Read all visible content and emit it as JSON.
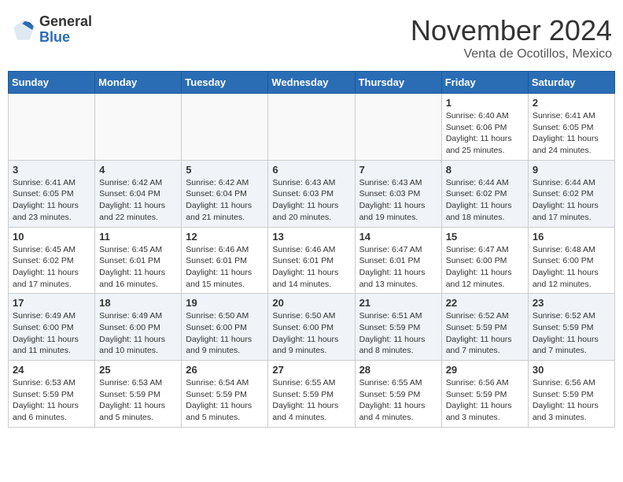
{
  "header": {
    "logo_general": "General",
    "logo_blue": "Blue",
    "month_title": "November 2024",
    "location": "Venta de Ocotillos, Mexico"
  },
  "weekdays": [
    "Sunday",
    "Monday",
    "Tuesday",
    "Wednesday",
    "Thursday",
    "Friday",
    "Saturday"
  ],
  "weeks": [
    [
      {
        "day": "",
        "info": ""
      },
      {
        "day": "",
        "info": ""
      },
      {
        "day": "",
        "info": ""
      },
      {
        "day": "",
        "info": ""
      },
      {
        "day": "",
        "info": ""
      },
      {
        "day": "1",
        "info": "Sunrise: 6:40 AM\nSunset: 6:06 PM\nDaylight: 11 hours\nand 25 minutes."
      },
      {
        "day": "2",
        "info": "Sunrise: 6:41 AM\nSunset: 6:05 PM\nDaylight: 11 hours\nand 24 minutes."
      }
    ],
    [
      {
        "day": "3",
        "info": "Sunrise: 6:41 AM\nSunset: 6:05 PM\nDaylight: 11 hours\nand 23 minutes."
      },
      {
        "day": "4",
        "info": "Sunrise: 6:42 AM\nSunset: 6:04 PM\nDaylight: 11 hours\nand 22 minutes."
      },
      {
        "day": "5",
        "info": "Sunrise: 6:42 AM\nSunset: 6:04 PM\nDaylight: 11 hours\nand 21 minutes."
      },
      {
        "day": "6",
        "info": "Sunrise: 6:43 AM\nSunset: 6:03 PM\nDaylight: 11 hours\nand 20 minutes."
      },
      {
        "day": "7",
        "info": "Sunrise: 6:43 AM\nSunset: 6:03 PM\nDaylight: 11 hours\nand 19 minutes."
      },
      {
        "day": "8",
        "info": "Sunrise: 6:44 AM\nSunset: 6:02 PM\nDaylight: 11 hours\nand 18 minutes."
      },
      {
        "day": "9",
        "info": "Sunrise: 6:44 AM\nSunset: 6:02 PM\nDaylight: 11 hours\nand 17 minutes."
      }
    ],
    [
      {
        "day": "10",
        "info": "Sunrise: 6:45 AM\nSunset: 6:02 PM\nDaylight: 11 hours\nand 17 minutes."
      },
      {
        "day": "11",
        "info": "Sunrise: 6:45 AM\nSunset: 6:01 PM\nDaylight: 11 hours\nand 16 minutes."
      },
      {
        "day": "12",
        "info": "Sunrise: 6:46 AM\nSunset: 6:01 PM\nDaylight: 11 hours\nand 15 minutes."
      },
      {
        "day": "13",
        "info": "Sunrise: 6:46 AM\nSunset: 6:01 PM\nDaylight: 11 hours\nand 14 minutes."
      },
      {
        "day": "14",
        "info": "Sunrise: 6:47 AM\nSunset: 6:01 PM\nDaylight: 11 hours\nand 13 minutes."
      },
      {
        "day": "15",
        "info": "Sunrise: 6:47 AM\nSunset: 6:00 PM\nDaylight: 11 hours\nand 12 minutes."
      },
      {
        "day": "16",
        "info": "Sunrise: 6:48 AM\nSunset: 6:00 PM\nDaylight: 11 hours\nand 12 minutes."
      }
    ],
    [
      {
        "day": "17",
        "info": "Sunrise: 6:49 AM\nSunset: 6:00 PM\nDaylight: 11 hours\nand 11 minutes."
      },
      {
        "day": "18",
        "info": "Sunrise: 6:49 AM\nSunset: 6:00 PM\nDaylight: 11 hours\nand 10 minutes."
      },
      {
        "day": "19",
        "info": "Sunrise: 6:50 AM\nSunset: 6:00 PM\nDaylight: 11 hours\nand 9 minutes."
      },
      {
        "day": "20",
        "info": "Sunrise: 6:50 AM\nSunset: 6:00 PM\nDaylight: 11 hours\nand 9 minutes."
      },
      {
        "day": "21",
        "info": "Sunrise: 6:51 AM\nSunset: 5:59 PM\nDaylight: 11 hours\nand 8 minutes."
      },
      {
        "day": "22",
        "info": "Sunrise: 6:52 AM\nSunset: 5:59 PM\nDaylight: 11 hours\nand 7 minutes."
      },
      {
        "day": "23",
        "info": "Sunrise: 6:52 AM\nSunset: 5:59 PM\nDaylight: 11 hours\nand 7 minutes."
      }
    ],
    [
      {
        "day": "24",
        "info": "Sunrise: 6:53 AM\nSunset: 5:59 PM\nDaylight: 11 hours\nand 6 minutes."
      },
      {
        "day": "25",
        "info": "Sunrise: 6:53 AM\nSunset: 5:59 PM\nDaylight: 11 hours\nand 5 minutes."
      },
      {
        "day": "26",
        "info": "Sunrise: 6:54 AM\nSunset: 5:59 PM\nDaylight: 11 hours\nand 5 minutes."
      },
      {
        "day": "27",
        "info": "Sunrise: 6:55 AM\nSunset: 5:59 PM\nDaylight: 11 hours\nand 4 minutes."
      },
      {
        "day": "28",
        "info": "Sunrise: 6:55 AM\nSunset: 5:59 PM\nDaylight: 11 hours\nand 4 minutes."
      },
      {
        "day": "29",
        "info": "Sunrise: 6:56 AM\nSunset: 5:59 PM\nDaylight: 11 hours\nand 3 minutes."
      },
      {
        "day": "30",
        "info": "Sunrise: 6:56 AM\nSunset: 5:59 PM\nDaylight: 11 hours\nand 3 minutes."
      }
    ]
  ]
}
